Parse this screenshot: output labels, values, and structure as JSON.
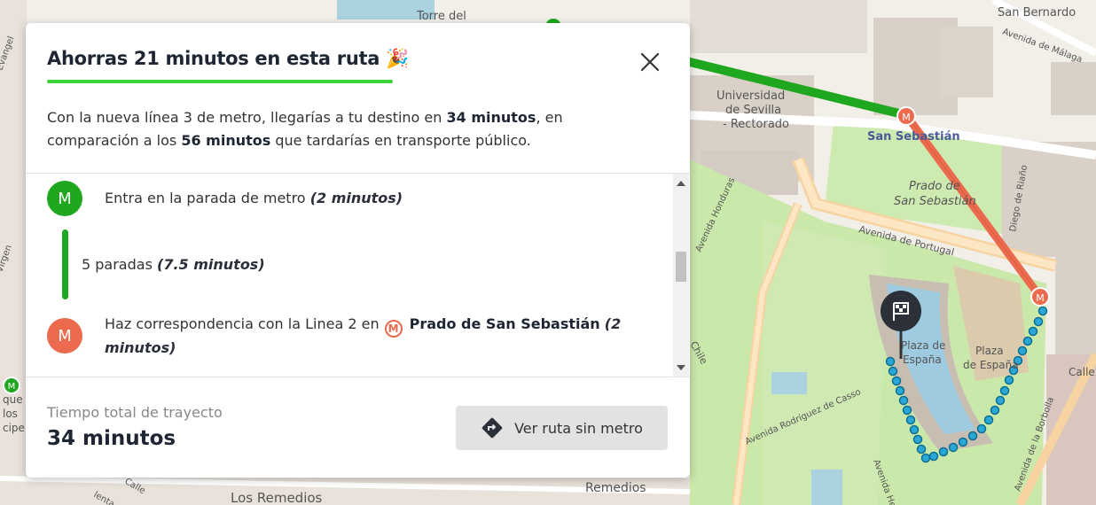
{
  "map": {
    "labels": {
      "torre": "Torre del",
      "san_bernardo": "San Bernardo",
      "universidad": "Universidad",
      "de_sevilla": "de Sevilla",
      "rectorado": "- Rectorado",
      "san_sebastian": "San Sebastián",
      "prado": "Prado de",
      "prado2": "San Sebastián",
      "avenida_portugal": "Avenida de Portugal",
      "avenida_honduras": "Avenida Honduras",
      "plaza_espana": "Plaza de",
      "plaza_espana2": "España",
      "plaza_right": "Plaza",
      "plaza_right2": "de España",
      "rodriguez_casso": "Avenida Rodríguez de Casso",
      "remedios": "Remedios",
      "los_remedios": "Los Remedios",
      "borbolla": "Avenida de la Borbolla",
      "diego_riano": "Diego de Riaño",
      "malaga": "Avenida de Málaga",
      "chile": "Chile",
      "calle": "Calle",
      "calle_l": "Calle L",
      "virgen": "Virgen",
      "evangel": "Evangel",
      "herc": "Avenida Her",
      "que": "que",
      "los": "los",
      "cipe": "cipe",
      "lenta": "lenta"
    },
    "metro_badge": "M"
  },
  "panel": {
    "title": "Ahorras 21 minutos en esta ruta",
    "title_emoji": "🎉",
    "intro": {
      "part1": "Con la nueva línea 3 de metro, llegarías a tu destino en ",
      "time_new": "34 minutos",
      "part2": ", en comparación a los ",
      "time_old": "56 minutos",
      "part3": " que tardarías en transporte público."
    },
    "steps": {
      "enter": {
        "badge": "M",
        "text": "Entra en la parada de metro ",
        "duration": "(2 minutos)"
      },
      "stops": {
        "text": "5 paradas ",
        "duration": "(7.5 minutos)"
      },
      "transfer": {
        "badge": "M",
        "text": "Haz correspondencia con la Linea 2 en",
        "station_icon": "M",
        "station": "Prado de San Sebastián",
        "duration": "(2 minutos)"
      }
    },
    "footer": {
      "label": "Tiempo total de trayecto",
      "value": "34 minutos",
      "button": "Ver ruta sin metro"
    },
    "colors": {
      "metro_line3": "#1fa81f",
      "metro_line2": "#ec6a4d",
      "underline": "#3cd33c",
      "route_dots": "#2aa7d4"
    }
  }
}
